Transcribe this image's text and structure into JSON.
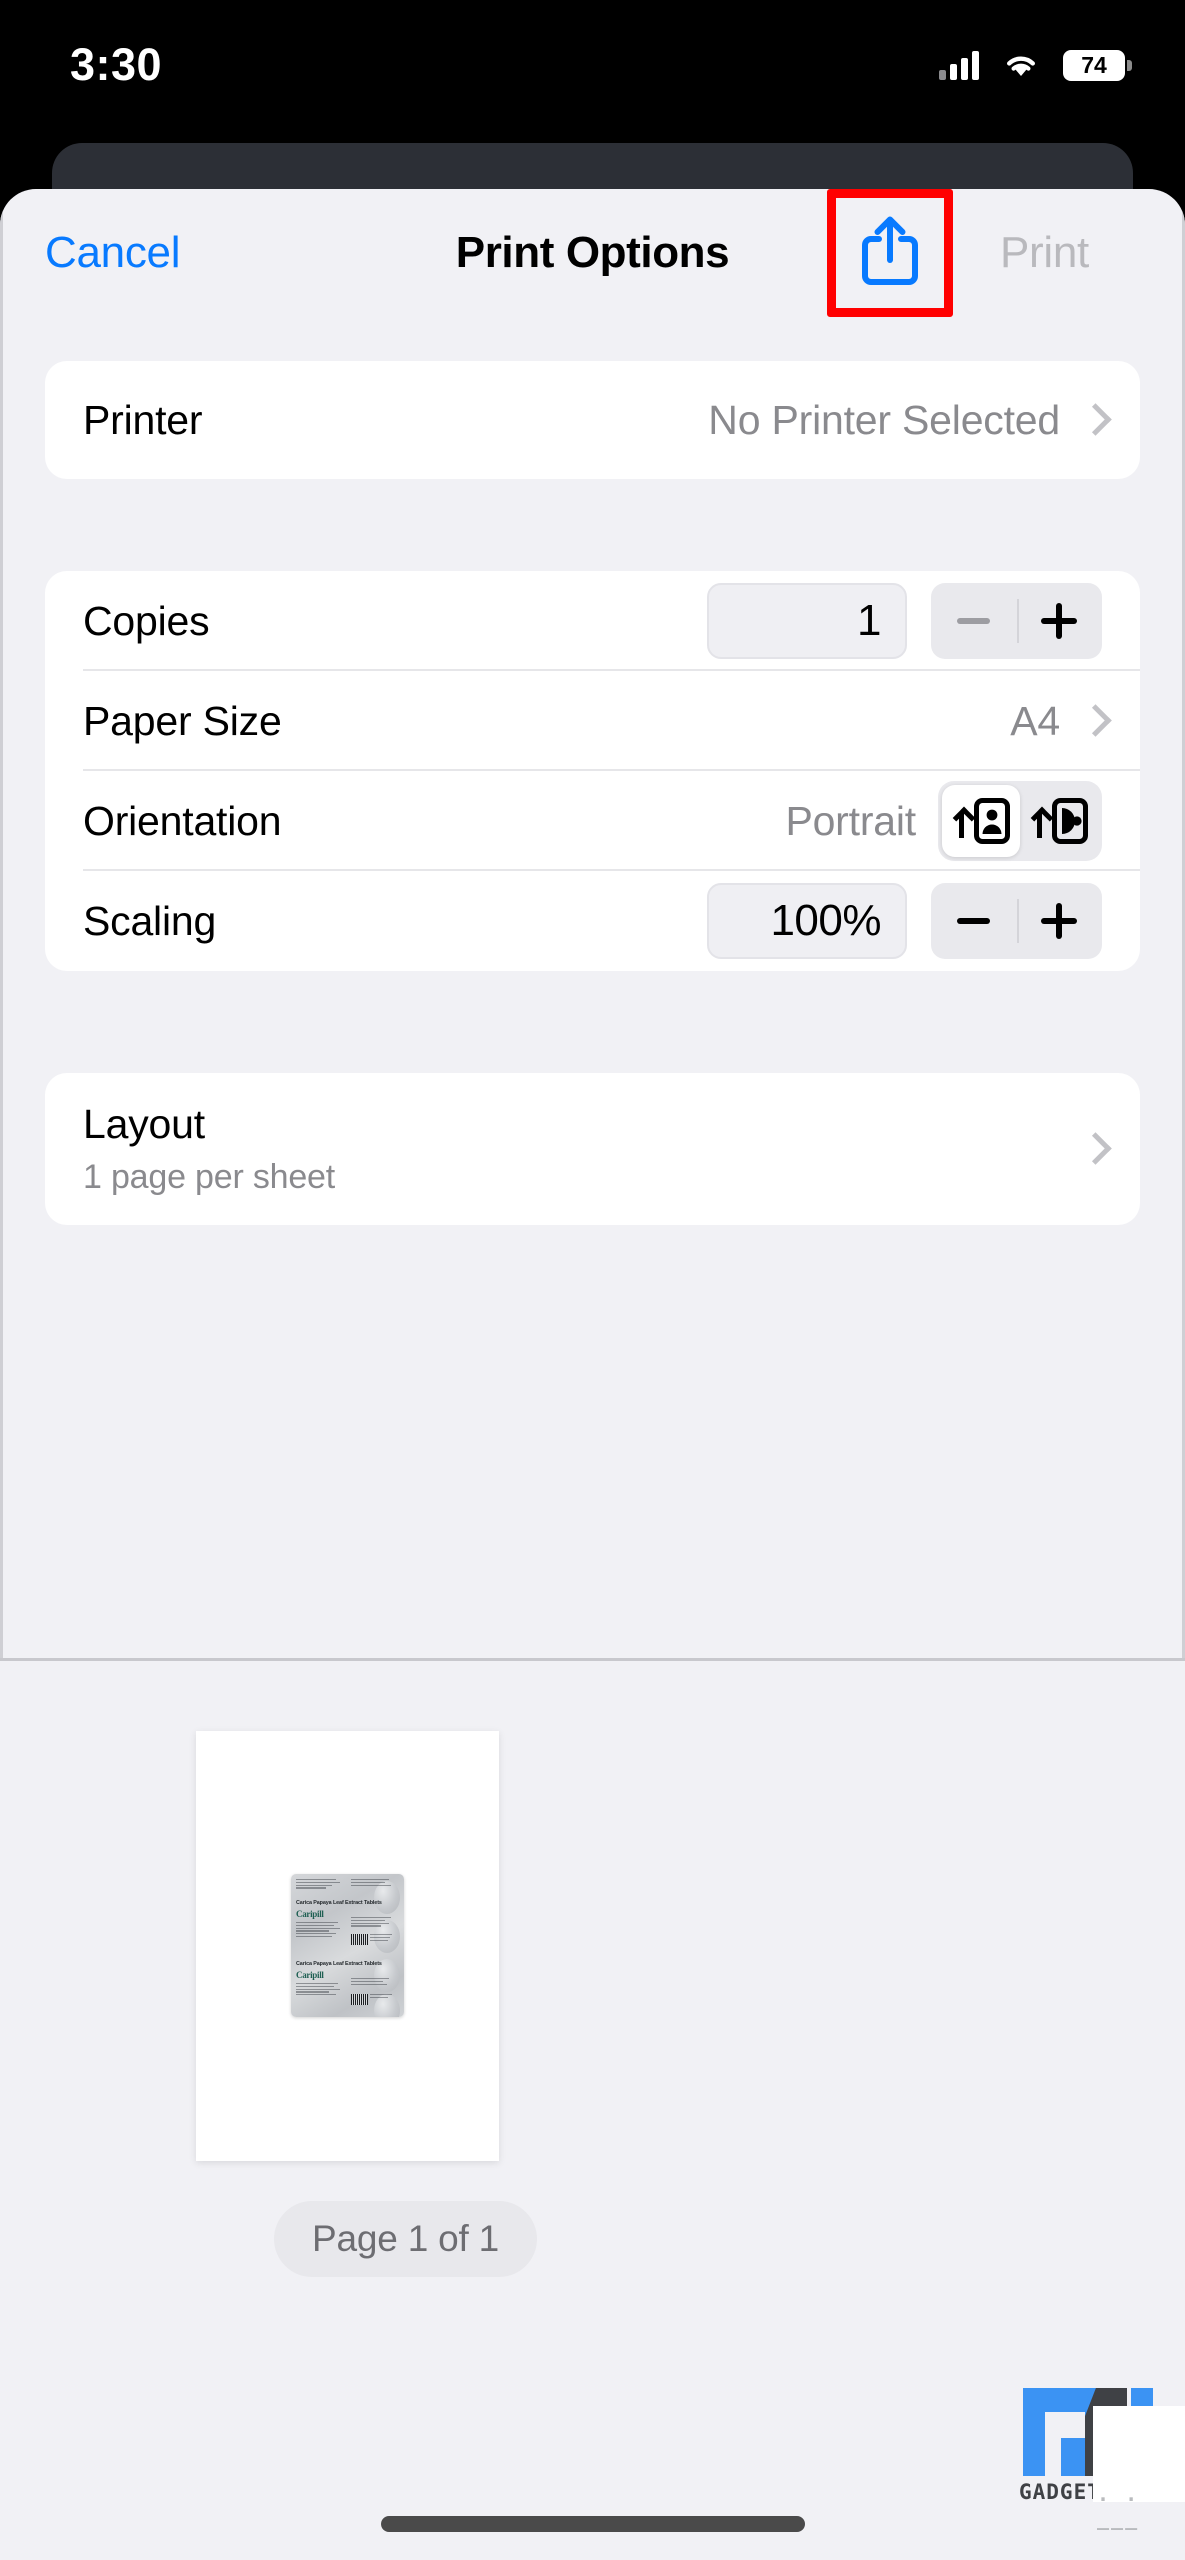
{
  "status_bar": {
    "time": "3:30",
    "battery_level": "74",
    "cellular_icon": "cellular-signal-icon",
    "wifi_icon": "wifi-icon",
    "battery_icon": "battery-icon"
  },
  "nav_bar": {
    "cancel_label": "Cancel",
    "title": "Print Options",
    "share_icon": "share-icon",
    "print_label": "Print",
    "highlight_color": "#ff0000",
    "accent_color": "#087aff",
    "print_disabled_color": "#b9b9bd"
  },
  "printer_section": {
    "label": "Printer",
    "value": "No Printer Selected",
    "chevron_icon": "chevron-right-icon"
  },
  "settings_section": {
    "copies": {
      "label": "Copies",
      "value": "1",
      "minus_icon": "minus-icon",
      "plus_icon": "plus-icon",
      "minus_disabled": true
    },
    "paper_size": {
      "label": "Paper Size",
      "value": "A4",
      "chevron_icon": "chevron-right-icon"
    },
    "orientation": {
      "label": "Orientation",
      "value": "Portrait",
      "portrait_icon": "orientation-portrait-icon",
      "landscape_icon": "orientation-landscape-icon",
      "selected": "portrait"
    },
    "scaling": {
      "label": "Scaling",
      "value": "100%",
      "minus_icon": "minus-icon",
      "plus_icon": "plus-icon",
      "minus_disabled": false
    }
  },
  "layout_section": {
    "label": "Layout",
    "subtitle": "1 page per sheet",
    "chevron_icon": "chevron-right-icon"
  },
  "preview": {
    "page_badge": "Page 1 of 1",
    "document_image": {
      "title_line_1": "Carica Papaya Leaf Extract Tablets",
      "brand_1": "Caripill",
      "title_line_2": "Carica Papaya Leaf Extract Tablets",
      "brand_2": "Caripill"
    }
  },
  "watermark": {
    "logo_icon": "gt-logo-icon",
    "text": "GADGETS",
    "dots": ". . ___",
    "brand_blue": "#3b93f3",
    "brand_dark": "#3f4145"
  }
}
